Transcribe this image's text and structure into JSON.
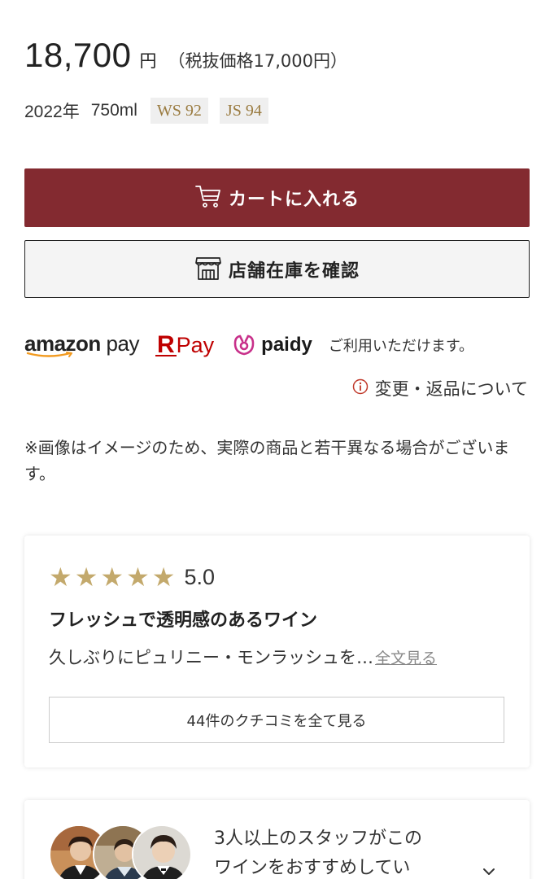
{
  "price": {
    "amount": "18,700",
    "currency": "円",
    "excl_tax": "（税抜価格17,000円）"
  },
  "meta": {
    "vintage": "2022年",
    "volume": "750ml",
    "scores": [
      "WS 92",
      "JS 94"
    ]
  },
  "buttons": {
    "cart": "カートに入れる",
    "store_stock": "店舗在庫を確認"
  },
  "payments": {
    "methods": [
      "amazon pay",
      "R Pay",
      "paidy"
    ],
    "note": "ご利用いただけます。"
  },
  "return_link": "変更・返品について",
  "disclaimer": "※画像はイメージのため、実際の商品と若干異なる場合がございます。",
  "review": {
    "stars": 5,
    "rating": "5.0",
    "title": "フレッシュで透明感のあるワイン",
    "excerpt": "久しぶりにピュリニー・モンラッシュを…",
    "read_more": "全文見る",
    "all_reviews": "44件のクチコミを全て見る"
  },
  "staff": {
    "text_line1": "3人以上のスタッフがこの",
    "text_line2": "ワインをおすすめしてい"
  },
  "colors": {
    "cart_button": "#832a30",
    "star": "#c3a96c",
    "score_text": "#9a7b40",
    "rpay": "#bf0000",
    "paidy": "#c8308a",
    "info_icon": "#c0392b"
  }
}
